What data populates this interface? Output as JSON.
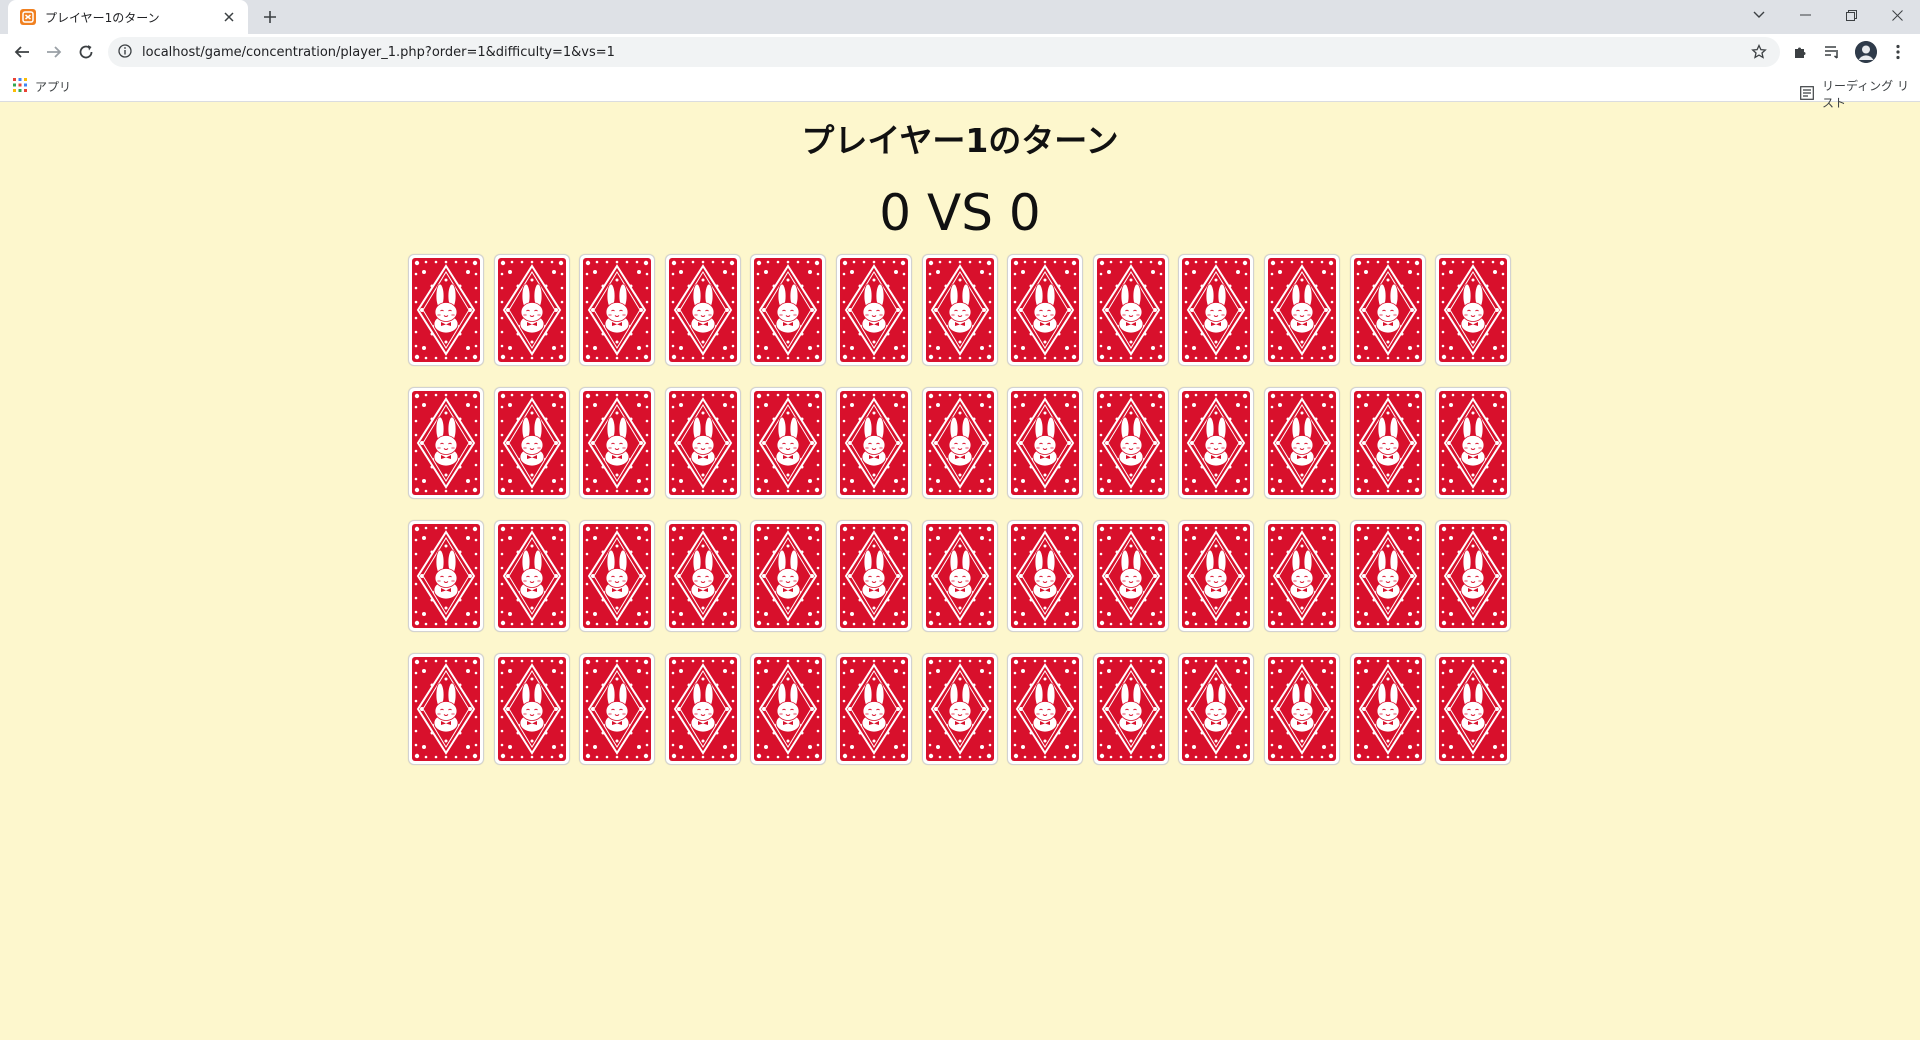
{
  "browser": {
    "tab_title": "プレイヤー1のターン",
    "url": "localhost/game/concentration/player_1.php?order=1&difficulty=1&vs=1",
    "bookmark_apps": "アプリ",
    "reading_list": "リーディング リスト"
  },
  "game": {
    "turn_title": "プレイヤー1のターン",
    "score_player1": "0",
    "score_vs": "VS",
    "score_player2": "0",
    "rows": 4,
    "cols": 13,
    "card_back": "rabbit-card-back",
    "card_color": "#d8102c"
  }
}
